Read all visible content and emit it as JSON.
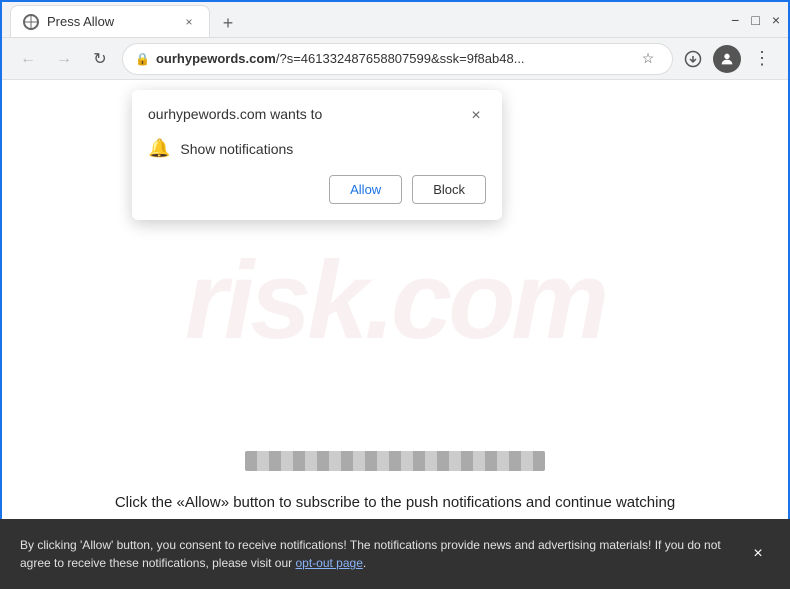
{
  "browser": {
    "tab": {
      "title": "Press Allow",
      "close_label": "×",
      "new_tab_label": "+"
    },
    "window_controls": {
      "minimize": "−",
      "maximize": "□",
      "close": "×"
    },
    "nav": {
      "back": "←",
      "forward": "→",
      "reload": "↻"
    },
    "address": {
      "url": "ourhypewords.com/?s=461332487658807599&ssk=9f8ab48...",
      "lock_symbol": "🔒",
      "domain_bold": "ourhypewords.com",
      "path": "/?s=461332487658807599&ssk=9f8ab48..."
    },
    "address_icons": {
      "star": "☆",
      "profile": "👤",
      "more": "⋮",
      "download": "⬇"
    }
  },
  "notification_dialog": {
    "title": "ourhypewords.com wants to",
    "permission_label": "Show notifications",
    "bell_icon": "🔔",
    "allow_label": "Allow",
    "block_label": "Block",
    "close_label": "×"
  },
  "page": {
    "watermark": "risk.com",
    "cta_text": "Click the «Allow» button to subscribe to the push notifications and continue watching"
  },
  "consent_bar": {
    "text": "By clicking 'Allow' button, you consent to receive notifications! The notifications provide news and advertising materials! If you do not agree to receive these notifications, please visit our ",
    "link_text": "opt-out page",
    "text_after": ".",
    "close_label": "×"
  }
}
